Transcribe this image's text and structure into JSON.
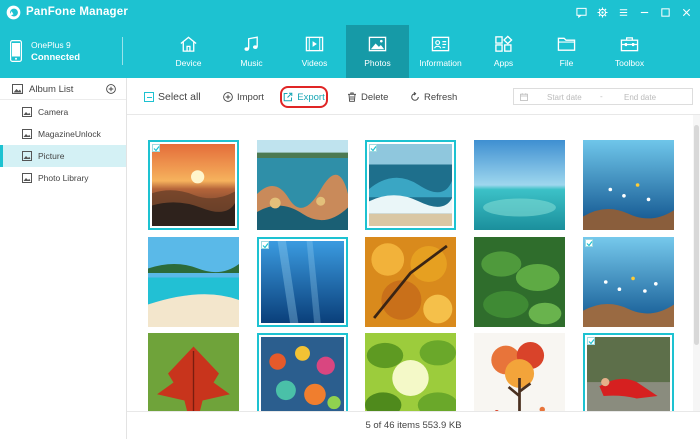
{
  "app": {
    "title": "PanFone Manager"
  },
  "device": {
    "name": "OnePlus 9",
    "status": "Connected"
  },
  "nav": [
    {
      "label": "Device",
      "icon": "home-icon"
    },
    {
      "label": "Music",
      "icon": "music-icon"
    },
    {
      "label": "Videos",
      "icon": "video-icon"
    },
    {
      "label": "Photos",
      "icon": "photo-icon",
      "active": true
    },
    {
      "label": "Information",
      "icon": "contact-card-icon"
    },
    {
      "label": "Apps",
      "icon": "apps-icon"
    },
    {
      "label": "File",
      "icon": "folder-icon"
    },
    {
      "label": "Toolbox",
      "icon": "toolbox-icon"
    }
  ],
  "sidebar": {
    "title": "Album List",
    "items": [
      {
        "label": "Camera"
      },
      {
        "label": "MagazineUnlock"
      },
      {
        "label": "Picture",
        "active": true
      },
      {
        "label": "Photo Library"
      }
    ]
  },
  "toolbar": {
    "select_all": "Select all",
    "import": "Import",
    "export": "Export",
    "delete": "Delete",
    "refresh": "Refresh",
    "start_date": "Start date",
    "date_sep": "-",
    "end_date": "End date"
  },
  "photos": [
    {
      "subject": "sunset over sea",
      "selected": true
    },
    {
      "subject": "coral reef",
      "selected": false
    },
    {
      "subject": "ocean wave",
      "selected": true
    },
    {
      "subject": "tropical lagoon",
      "selected": false
    },
    {
      "subject": "reef fish",
      "selected": false
    },
    {
      "subject": "tropical beach",
      "selected": false
    },
    {
      "subject": "underwater light",
      "selected": true
    },
    {
      "subject": "autumn leaves",
      "selected": false
    },
    {
      "subject": "green leaves",
      "selected": false
    },
    {
      "subject": "reef fish school",
      "selected": false
    },
    {
      "subject": "red leaf",
      "selected": false
    },
    {
      "subject": "colorful coral",
      "selected": false
    },
    {
      "subject": "leaves backlit",
      "selected": false
    },
    {
      "subject": "painted tree",
      "selected": false
    },
    {
      "subject": "woman in red dress",
      "selected": true
    }
  ],
  "status": {
    "text": "5 of 46 items 553.9 KB"
  },
  "colors": {
    "accent": "#1dc2d1",
    "active_nav": "#169aa7",
    "highlight": "#e02525"
  }
}
